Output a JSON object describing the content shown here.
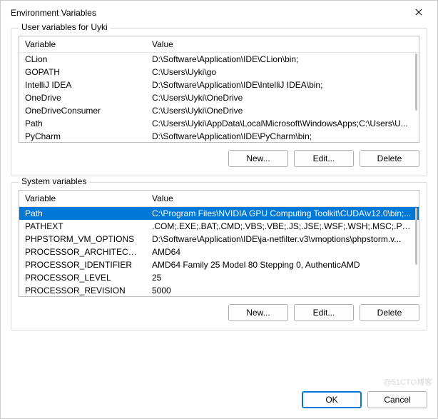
{
  "window": {
    "title": "Environment Variables",
    "close_icon": "close"
  },
  "user_section": {
    "label": "User variables for Uyki",
    "header_variable": "Variable",
    "header_value": "Value",
    "rows": [
      {
        "variable": "CLion",
        "value": "D:\\Software\\Application\\IDE\\CLion\\bin;"
      },
      {
        "variable": "GOPATH",
        "value": "C:\\Users\\Uyki\\go"
      },
      {
        "variable": "IntelliJ IDEA",
        "value": "D:\\Software\\Application\\IDE\\IntelliJ IDEA\\bin;"
      },
      {
        "variable": "OneDrive",
        "value": "C:\\Users\\Uyki\\OneDrive"
      },
      {
        "variable": "OneDriveConsumer",
        "value": "C:\\Users\\Uyki\\OneDrive"
      },
      {
        "variable": "Path",
        "value": "C:\\Users\\Uyki\\AppData\\Local\\Microsoft\\WindowsApps;C:\\Users\\U..."
      },
      {
        "variable": "PyCharm",
        "value": "D:\\Software\\Application\\IDE\\PyCharm\\bin;"
      }
    ],
    "buttons": {
      "new": "New...",
      "edit": "Edit...",
      "delete": "Delete"
    }
  },
  "system_section": {
    "label": "System variables",
    "header_variable": "Variable",
    "header_value": "Value",
    "rows": [
      {
        "variable": "Path",
        "value": "C:\\Program Files\\NVIDIA GPU Computing Toolkit\\CUDA\\v12.0\\bin;...",
        "selected": true
      },
      {
        "variable": "PATHEXT",
        "value": ".COM;.EXE;.BAT;.CMD;.VBS;.VBE;.JS;.JSE;.WSF;.WSH;.MSC;.PY;.PYW"
      },
      {
        "variable": "PHPSTORM_VM_OPTIONS",
        "value": "D:\\Software\\Application\\IDE\\ja-netfilter.v3\\vmoptions\\phpstorm.v..."
      },
      {
        "variable": "PROCESSOR_ARCHITECTURE",
        "value": "AMD64"
      },
      {
        "variable": "PROCESSOR_IDENTIFIER",
        "value": "AMD64 Family 25 Model 80 Stepping 0, AuthenticAMD"
      },
      {
        "variable": "PROCESSOR_LEVEL",
        "value": "25"
      },
      {
        "variable": "PROCESSOR_REVISION",
        "value": "5000"
      }
    ],
    "buttons": {
      "new": "New...",
      "edit": "Edit...",
      "delete": "Delete"
    }
  },
  "footer": {
    "ok": "OK",
    "cancel": "Cancel"
  },
  "watermark": "@51CTO博客"
}
